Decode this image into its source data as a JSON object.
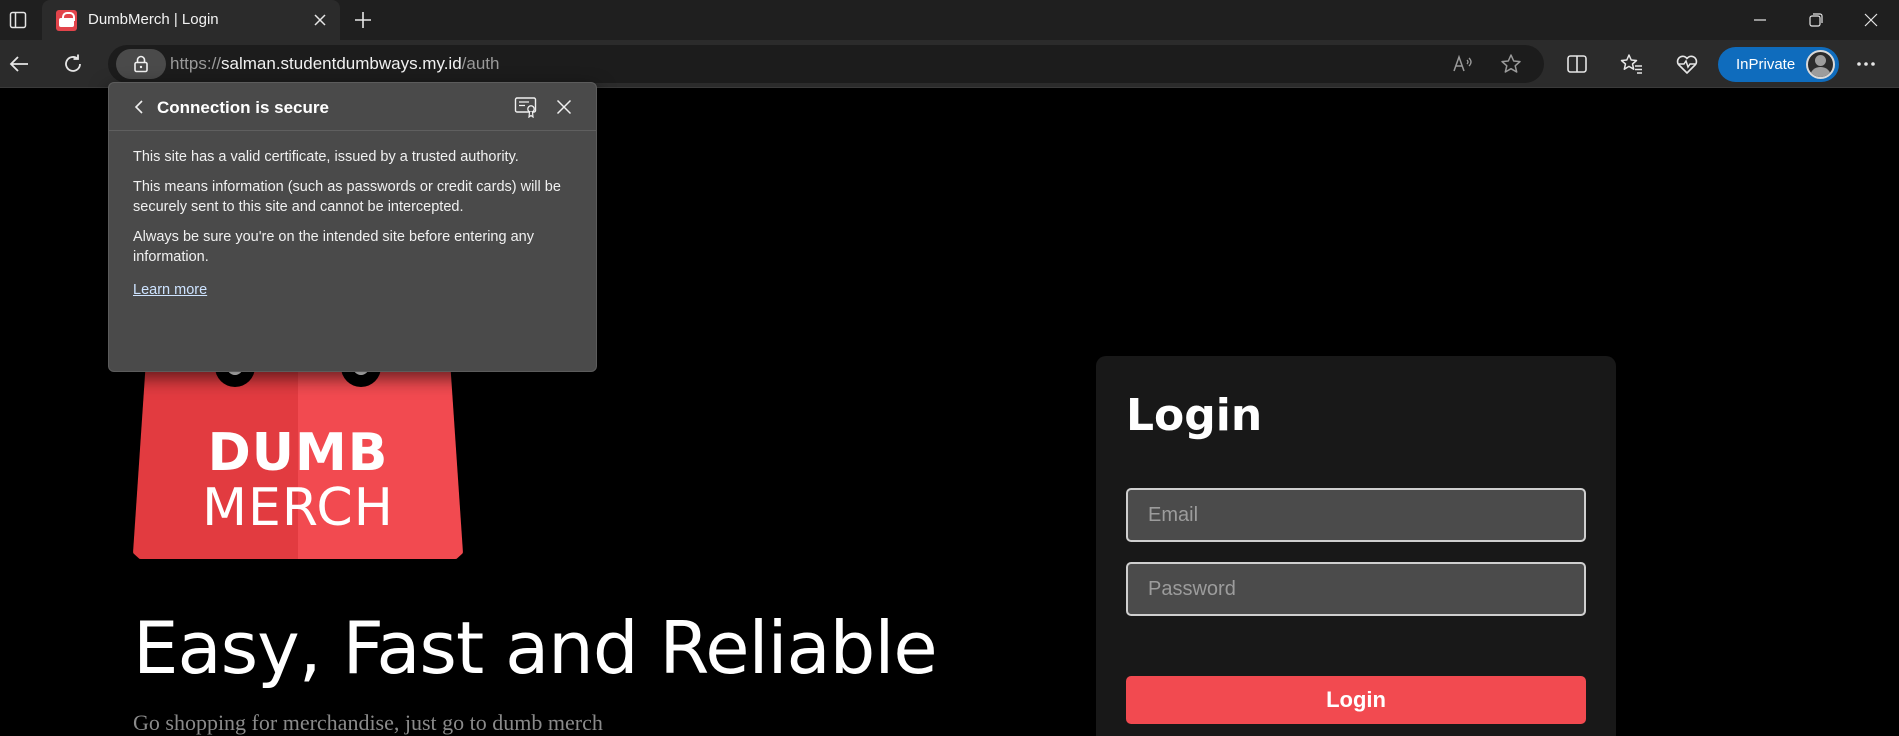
{
  "browser": {
    "tab": {
      "title": "DumbMerch | Login"
    },
    "address": {
      "scheme": "https://",
      "host": "salman.studentdumbways.my.id",
      "path": "/auth"
    },
    "inprivate_label": "InPrivate",
    "accent_color": "#0f6cbd"
  },
  "site_info_popup": {
    "title": "Connection is secure",
    "paragraphs": [
      "This site has a valid certificate, issued by a trusted authority.",
      "This means information (such as passwords or credit cards) will be securely sent to this site and cannot be intercepted.",
      "Always be sure you're on the intended site before entering any information."
    ],
    "learn_more": "Learn more"
  },
  "page": {
    "logo": {
      "line1": "DUMB",
      "line2": "MERCH"
    },
    "hero_title": "Easy, Fast and Reliable",
    "hero_subtitle": "Go shopping for merchandise, just go to dumb merch",
    "brand_color": "#f24a50",
    "login": {
      "title": "Login",
      "email_placeholder": "Email",
      "email_value": "",
      "password_placeholder": "Password",
      "password_value": "",
      "submit_label": "Login"
    }
  }
}
